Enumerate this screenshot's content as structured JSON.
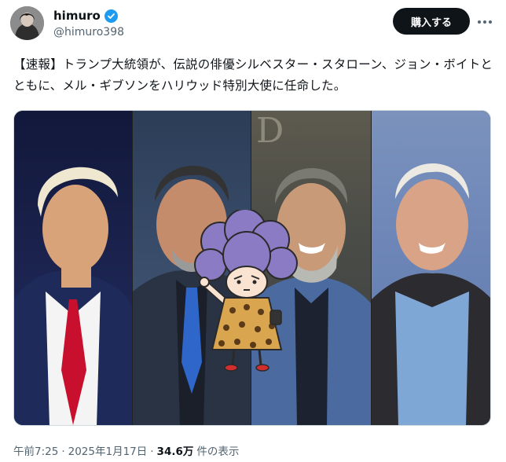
{
  "user": {
    "display_name": "himuro",
    "handle": "@himuro398",
    "verified": true
  },
  "actions": {
    "buy_label": "購入する",
    "more_icon": "more-horizontal-icon"
  },
  "tweet": {
    "text": "【速報】トランプ大統領が、伝説の俳優シルベスター・スタローン、ジョン・ボイトとともに、メル・ギブソンをハリウッド特別大使に任命した。"
  },
  "media": {
    "panels": [
      "portrait-1",
      "portrait-2",
      "portrait-3",
      "portrait-4"
    ],
    "sticker": "cartoon-character-sticker"
  },
  "meta": {
    "time": "午前7:25",
    "separator": "·",
    "date": "2025年1月17日",
    "views_count": "34.6万",
    "views_label": "件の表示"
  },
  "colors": {
    "verified_blue": "#1d9bf0",
    "button_bg": "#0f1419",
    "muted_text": "#536471"
  }
}
